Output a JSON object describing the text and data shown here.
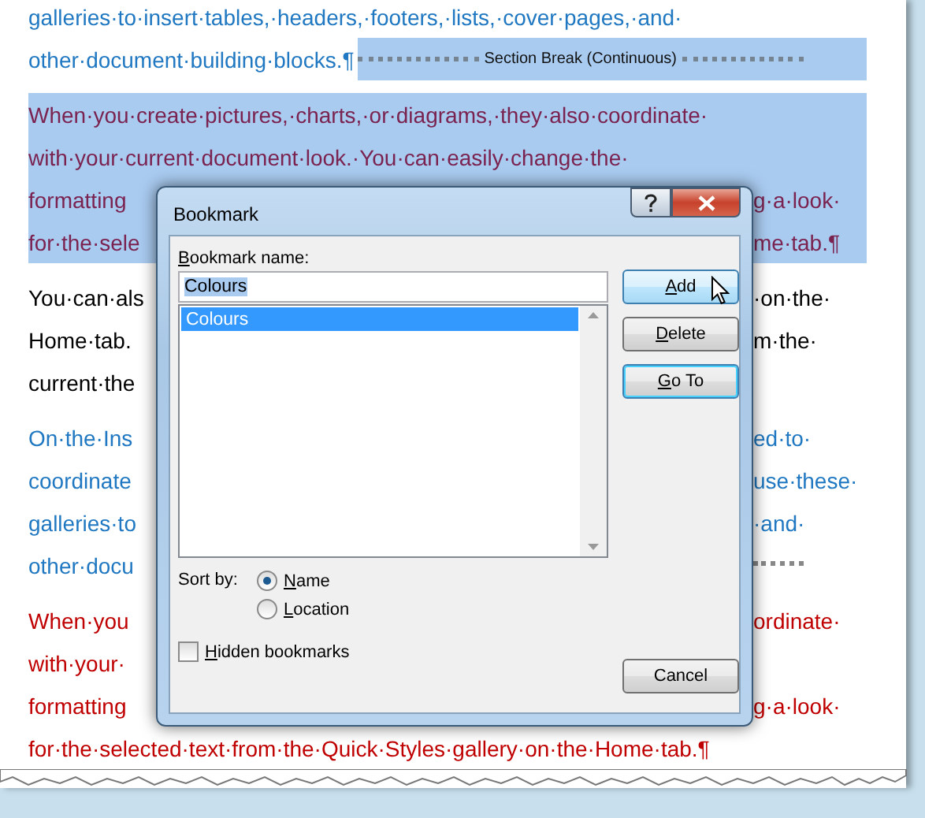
{
  "document": {
    "paragraphs": [
      {
        "color": "#1f78c1",
        "selected": false,
        "lines": [
          {
            "left": "galleries·to·insert·tables,·headers,·footers,·lists,·cover·pages,·and·"
          },
          {
            "left": "other·document·building·blocks.¶",
            "section_break": true,
            "section_break_label": "Section Break (Continuous)",
            "section_break_selected": true
          }
        ]
      },
      {
        "color": "#7b2350",
        "selected": true,
        "lines": [
          {
            "left": "When·you·create·pictures,·charts,·or·diagrams,·they·also·coordinate·"
          },
          {
            "left": "with·your·current·document·look.·You·can·easily·change·the·"
          },
          {
            "left": "formatting",
            "right": "g·a·look·"
          },
          {
            "left": "for·the·sele",
            "right": "me·tab.¶"
          }
        ]
      },
      {
        "color": "#000000",
        "selected": false,
        "lines": [
          {
            "left": "You·can·als",
            "right": "·on·the·"
          },
          {
            "left": "Home·tab.",
            "right": "m·the·"
          },
          {
            "left": "current·the"
          }
        ]
      },
      {
        "color": "#1f78c1",
        "selected": false,
        "lines": [
          {
            "left": "On·the·Ins",
            "right": "ed·to·"
          },
          {
            "left": "coordinate",
            "right": "use·these·"
          },
          {
            "left": "galleries·to",
            "right": "·and·"
          },
          {
            "left": "other·docu",
            "section_break": true,
            "section_break_selected": false
          }
        ]
      },
      {
        "color": "#c00000",
        "selected": false,
        "lines": [
          {
            "left": "When·you",
            "right": "ordinate·"
          },
          {
            "left": "with·your·"
          },
          {
            "left": "formatting",
            "right": "g·a·look·"
          },
          {
            "left": "for·the·selected·text·from·the·Quick·Styles·gallery·on·the·Home·tab.¶"
          }
        ]
      }
    ]
  },
  "dialog": {
    "title": "Bookmark",
    "name_label": "Bookmark name:",
    "name_value": "Colours",
    "bookmarks": [
      {
        "label": "Colours",
        "selected": true
      }
    ],
    "buttons": [
      {
        "label": "Add",
        "hover": true,
        "focused": false
      },
      {
        "label": "Delete",
        "hover": false,
        "focused": false
      },
      {
        "label": "Go To",
        "hover": false,
        "focused": true
      }
    ],
    "sort_label": "Sort by:",
    "sort_options": [
      {
        "label": "Name",
        "selected": true
      },
      {
        "label": "Location",
        "selected": false
      }
    ],
    "hidden": {
      "label": "Hidden bookmarks",
      "checked": false
    },
    "cancel": {
      "label": "Cancel"
    }
  }
}
